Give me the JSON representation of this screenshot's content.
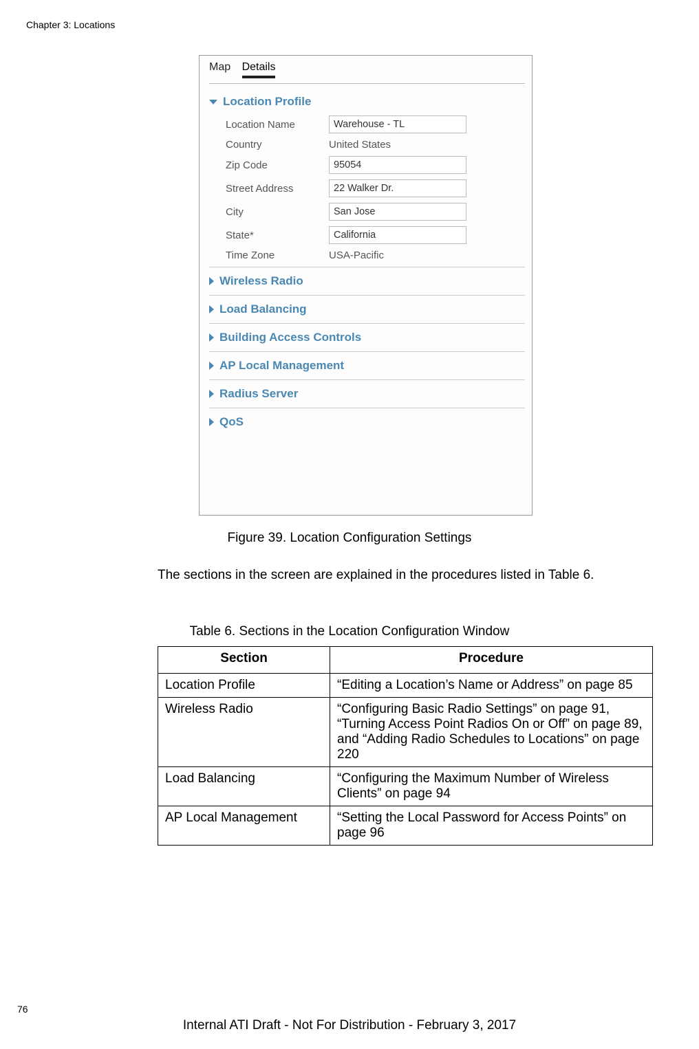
{
  "header": "Chapter 3: Locations",
  "page_number": "76",
  "footer": "Internal ATI Draft - Not For Distribution - February 3, 2017",
  "figure": {
    "tabs": {
      "map": "Map",
      "details": "Details"
    },
    "sections": {
      "location_profile": {
        "title": "Location Profile",
        "rows": {
          "location_name": {
            "label": "Location Name",
            "value": "Warehouse - TL"
          },
          "country": {
            "label": "Country",
            "value": "United States"
          },
          "zip": {
            "label": "Zip Code",
            "value": "95054"
          },
          "street": {
            "label": "Street Address",
            "value": "22 Walker Dr."
          },
          "city": {
            "label": "City",
            "value": "San Jose"
          },
          "state": {
            "label": "State*",
            "value": "California"
          },
          "timezone": {
            "label": "Time Zone",
            "value": "USA-Pacific"
          }
        }
      },
      "wireless_radio": "Wireless Radio",
      "load_balancing": "Load Balancing",
      "building_access": "Building Access Controls",
      "ap_local": "AP Local Management",
      "radius": "Radius Server",
      "qos": "QoS"
    }
  },
  "figure_caption": "Figure 39. Location Configuration Settings",
  "body_text": "The sections in the screen are explained in the procedures listed in Table 6.",
  "table_caption": "Table 6. Sections in the Location Configuration Window",
  "table": {
    "headers": {
      "section": "Section",
      "procedure": "Procedure"
    },
    "rows": [
      {
        "section": "Location Profile",
        "procedure": "“Editing a Location’s Name or Address” on page 85"
      },
      {
        "section": "Wireless Radio",
        "procedure": "“Configuring Basic Radio Settings” on page 91, “Turning Access Point Radios On or Off” on page 89, and “Adding Radio Schedules to Locations” on page 220"
      },
      {
        "section": "Load Balancing",
        "procedure": "“Configuring the Maximum Number of Wireless Clients” on page 94"
      },
      {
        "section": "AP Local Management",
        "procedure": "“Setting the Local Password for Access Points” on page 96"
      }
    ]
  }
}
